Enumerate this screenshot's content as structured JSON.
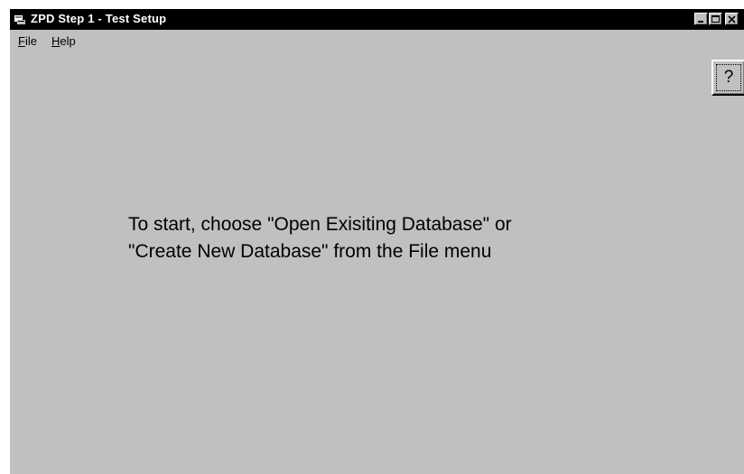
{
  "window": {
    "title": "ZPD Step 1 - Test Setup",
    "app_icon": "application-icon",
    "controls": {
      "minimize_icon": "minimize-icon",
      "maximize_icon": "maximize-icon",
      "close_icon": "close-icon"
    }
  },
  "menu": {
    "file": {
      "mnemonic": "F",
      "rest": "ile"
    },
    "help": {
      "mnemonic": "H",
      "rest": "elp"
    }
  },
  "help_button": {
    "label": "?"
  },
  "instructions": {
    "line1": "To start, choose \"Open Exisiting Database\" or",
    "line2": "\"Create New Database\" from the File menu"
  },
  "colors": {
    "titlebar": "#000000",
    "face": "#c0c0c0",
    "text": "#000000"
  }
}
